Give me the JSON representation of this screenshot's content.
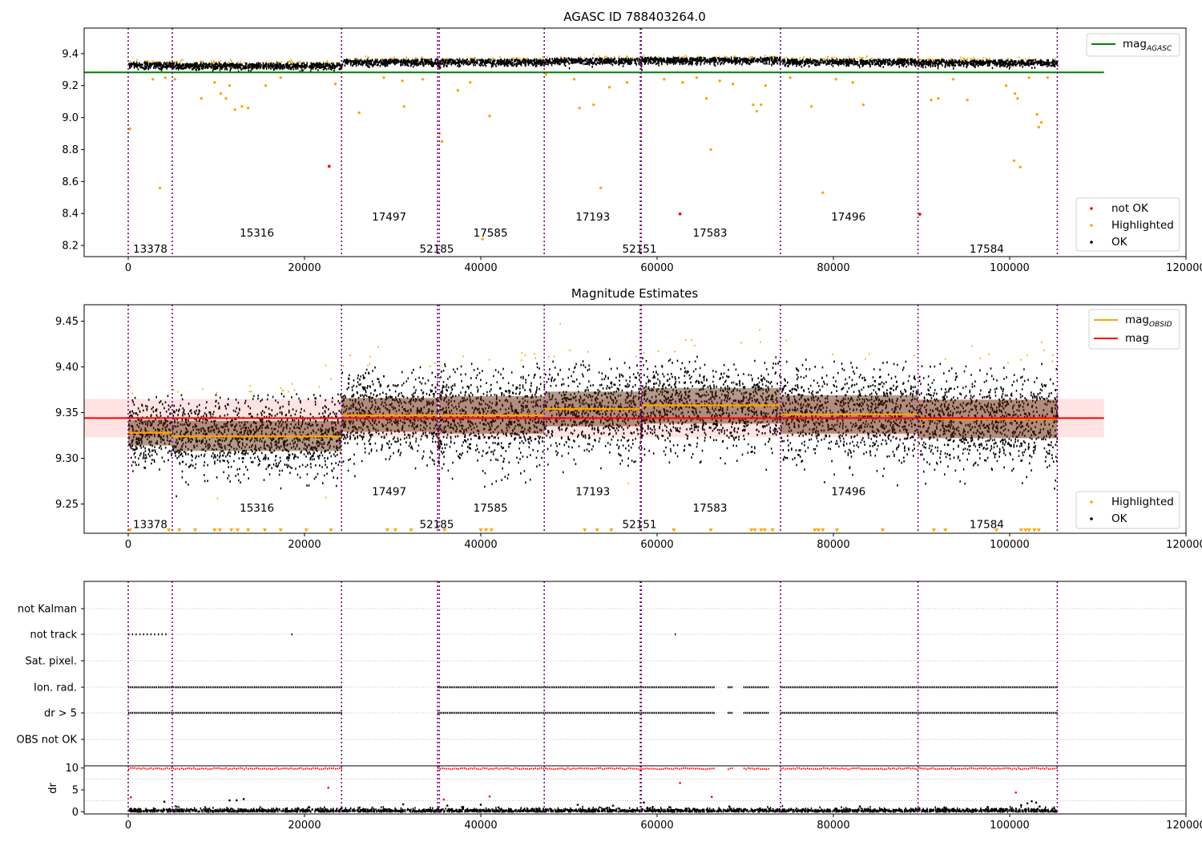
{
  "chart_data": [
    {
      "type": "scatter",
      "title": "AGASC ID 788403264.0",
      "xlim": [
        -5000,
        120000
      ],
      "ylim": [
        8.13,
        9.56
      ],
      "x_ticks": [
        0,
        20000,
        40000,
        60000,
        80000,
        100000,
        120000
      ],
      "y_ticks": [
        8.2,
        8.4,
        8.6,
        8.8,
        9.0,
        9.2,
        9.4
      ],
      "mag_agasc": 9.283,
      "mag_agasc_x_range": [
        -5000,
        110700
      ],
      "legend_lines": [
        {
          "label": "mag",
          "subscript": "AGASC",
          "color": "#008000"
        }
      ],
      "legend_points": [
        {
          "label": "not OK",
          "color": "#ff0000"
        },
        {
          "label": "Highlighted",
          "color": "#ffa500"
        },
        {
          "label": "OK",
          "color": "#000000"
        }
      ],
      "not_ok_points": [
        [
          22800,
          8.695
        ],
        [
          62600,
          8.397
        ],
        [
          89800,
          8.395
        ]
      ],
      "highlighted_outliers": [
        [
          200,
          8.93
        ],
        [
          3600,
          8.56
        ],
        [
          2800,
          9.24
        ],
        [
          4200,
          9.25
        ],
        [
          5300,
          9.24
        ],
        [
          8300,
          9.12
        ],
        [
          9800,
          9.22
        ],
        [
          10500,
          9.15
        ],
        [
          11100,
          9.12
        ],
        [
          11500,
          9.2
        ],
        [
          12100,
          9.05
        ],
        [
          12900,
          9.07
        ],
        [
          13600,
          9.06
        ],
        [
          15600,
          9.2
        ],
        [
          17300,
          9.25
        ],
        [
          23500,
          9.21
        ],
        [
          26200,
          9.03
        ],
        [
          29000,
          9.25
        ],
        [
          31100,
          9.23
        ],
        [
          31300,
          9.07
        ],
        [
          33400,
          9.24
        ],
        [
          35600,
          8.85
        ],
        [
          35300,
          8.9
        ],
        [
          37400,
          9.17
        ],
        [
          38800,
          9.22
        ],
        [
          40200,
          8.24
        ],
        [
          41000,
          9.01
        ],
        [
          47400,
          9.27
        ],
        [
          50600,
          9.24
        ],
        [
          51200,
          9.06
        ],
        [
          52800,
          9.08
        ],
        [
          53600,
          8.56
        ],
        [
          54600,
          9.19
        ],
        [
          56600,
          9.22
        ],
        [
          58200,
          8.9
        ],
        [
          60800,
          9.24
        ],
        [
          62900,
          9.22
        ],
        [
          64500,
          9.25
        ],
        [
          65600,
          9.12
        ],
        [
          66100,
          8.8
        ],
        [
          67100,
          9.23
        ],
        [
          68600,
          9.21
        ],
        [
          70900,
          9.08
        ],
        [
          71300,
          9.04
        ],
        [
          71800,
          9.08
        ],
        [
          72300,
          9.2
        ],
        [
          75100,
          9.25
        ],
        [
          77500,
          9.07
        ],
        [
          78800,
          8.53
        ],
        [
          80300,
          9.24
        ],
        [
          82200,
          9.22
        ],
        [
          83400,
          9.08
        ],
        [
          91100,
          9.11
        ],
        [
          91900,
          9.12
        ],
        [
          93600,
          9.24
        ],
        [
          95200,
          9.11
        ],
        [
          99600,
          9.2
        ],
        [
          100500,
          8.73
        ],
        [
          101200,
          8.69
        ],
        [
          100600,
          9.15
        ],
        [
          100900,
          9.12
        ],
        [
          102200,
          9.25
        ],
        [
          103100,
          9.02
        ],
        [
          103300,
          8.94
        ],
        [
          103600,
          8.97
        ],
        [
          104300,
          9.25
        ]
      ],
      "obsids": [
        {
          "label": "13378",
          "x": 2500,
          "y": 8.18
        },
        {
          "label": "15316",
          "x": 14600,
          "y": 8.28
        },
        {
          "label": "17497",
          "x": 29600,
          "y": 8.38
        },
        {
          "label": "52185",
          "x": 35000,
          "y": 8.18
        },
        {
          "label": "17585",
          "x": 41100,
          "y": 8.28
        },
        {
          "label": "17193",
          "x": 52700,
          "y": 8.38
        },
        {
          "label": "52151",
          "x": 58000,
          "y": 8.18
        },
        {
          "label": "17583",
          "x": 66000,
          "y": 8.28
        },
        {
          "label": "17496",
          "x": 81700,
          "y": 8.38
        },
        {
          "label": "17584",
          "x": 97400,
          "y": 8.18
        }
      ]
    },
    {
      "type": "scatter",
      "title": "Magnitude Estimates",
      "xlim": [
        -5000,
        120000
      ],
      "ylim": [
        9.218,
        9.468
      ],
      "x_ticks": [
        0,
        20000,
        40000,
        60000,
        80000,
        100000,
        120000
      ],
      "y_ticks": [
        9.25,
        9.3,
        9.35,
        9.4,
        9.45
      ],
      "mag": 9.344,
      "mag_band": [
        9.323,
        9.365
      ],
      "mag_x_range": [
        -5000,
        110700
      ],
      "legend_lines": [
        {
          "label": "mag",
          "subscript": "OBSID",
          "color": "#ffa500"
        },
        {
          "label": "mag",
          "subscript": "",
          "color": "#ff0000"
        }
      ],
      "legend_points": [
        {
          "label": "Highlighted",
          "color": "#ffa500"
        },
        {
          "label": "OK",
          "color": "#000000"
        }
      ],
      "obsid_mags": [
        {
          "x0": 0,
          "x1": 5000,
          "mag": 9.328,
          "low": 9.314,
          "high": 9.342
        },
        {
          "x0": 5000,
          "x1": 24200,
          "mag": 9.324,
          "low": 9.308,
          "high": 9.341
        },
        {
          "x0": 24200,
          "x1": 35100,
          "mag": 9.347,
          "low": 9.329,
          "high": 9.366
        },
        {
          "x0": 35100,
          "x1": 35300,
          "mag": 9.324,
          "low": 9.31,
          "high": 9.34
        },
        {
          "x0": 35300,
          "x1": 47200,
          "mag": 9.347,
          "low": 9.327,
          "high": 9.368
        },
        {
          "x0": 47200,
          "x1": 58100,
          "mag": 9.354,
          "low": 9.335,
          "high": 9.373
        },
        {
          "x0": 58100,
          "x1": 58200,
          "mag": 9.33,
          "low": 9.316,
          "high": 9.345
        },
        {
          "x0": 58200,
          "x1": 74000,
          "mag": 9.358,
          "low": 9.338,
          "high": 9.377
        },
        {
          "x0": 74000,
          "x1": 89600,
          "mag": 9.348,
          "low": 9.327,
          "high": 9.369
        },
        {
          "x0": 89600,
          "x1": 105400,
          "mag": 9.343,
          "low": 9.322,
          "high": 9.364
        }
      ],
      "obsids": [
        {
          "label": "13378",
          "x": 2500,
          "y": 9.228
        },
        {
          "label": "15316",
          "x": 14600,
          "y": 9.246
        },
        {
          "label": "17497",
          "x": 29600,
          "y": 9.264
        },
        {
          "label": "52185",
          "x": 35000,
          "y": 9.228
        },
        {
          "label": "17585",
          "x": 41100,
          "y": 9.246
        },
        {
          "label": "17193",
          "x": 52700,
          "y": 9.264
        },
        {
          "label": "52151",
          "x": 58000,
          "y": 9.228
        },
        {
          "label": "17583",
          "x": 66000,
          "y": 9.246
        },
        {
          "label": "17496",
          "x": 81700,
          "y": 9.264
        },
        {
          "label": "17584",
          "x": 97400,
          "y": 9.228
        }
      ]
    },
    {
      "type": "scatter",
      "title": "",
      "xlim": [
        -5000,
        120000
      ],
      "categories": [
        "not Kalman",
        "not track",
        "Sat. pixel.",
        "Ion. rad.",
        "dr > 5",
        "OBS not OK"
      ],
      "not_track_ranges": [
        [
          0,
          4500
        ],
        [
          18500,
          18700
        ],
        [
          62000,
          62200
        ]
      ],
      "ion_rad_ranges": [
        [
          0,
          24200
        ],
        [
          35100,
          66500
        ],
        [
          68000,
          68500
        ],
        [
          69800,
          72600
        ],
        [
          74000,
          105400
        ]
      ],
      "dr_gt5_ranges": [
        [
          0,
          24200
        ],
        [
          35100,
          66500
        ],
        [
          68000,
          68500
        ],
        [
          69800,
          72600
        ],
        [
          74000,
          105400
        ]
      ]
    },
    {
      "type": "scatter",
      "title": "",
      "xlim": [
        -5000,
        120000
      ],
      "ylim": [
        -0.5,
        10.5
      ],
      "ylabel": "dr",
      "x_ticks": [
        0,
        20000,
        40000,
        60000,
        80000,
        100000,
        120000
      ],
      "y_ticks": [
        0,
        5,
        10
      ],
      "red_outliers": [
        [
          22700,
          5.5
        ],
        [
          62600,
          6.6
        ],
        [
          41000,
          3.5
        ],
        [
          66200,
          3.4
        ],
        [
          100700,
          4.4
        ],
        [
          300,
          3.3
        ],
        [
          35800,
          2.8
        ]
      ],
      "black_outliers": [
        [
          4100,
          2.3
        ],
        [
          11500,
          2.6
        ],
        [
          12300,
          2.6
        ],
        [
          13100,
          2.9
        ],
        [
          31200,
          1.7
        ],
        [
          36200,
          1.4
        ],
        [
          38000,
          1.1
        ],
        [
          40000,
          1.6
        ],
        [
          42000,
          1.0
        ],
        [
          51000,
          1.6
        ],
        [
          53500,
          1.0
        ],
        [
          55000,
          1.4
        ],
        [
          58500,
          2.1
        ],
        [
          59500,
          1.1
        ],
        [
          61500,
          1.0
        ],
        [
          68200,
          1.2
        ],
        [
          83000,
          1.2
        ],
        [
          92600,
          1.0
        ],
        [
          97500,
          1.1
        ],
        [
          101300,
          1.5
        ],
        [
          102000,
          1.9
        ],
        [
          102500,
          2.4
        ],
        [
          103000,
          2.1
        ],
        [
          103400,
          1.2
        ]
      ]
    }
  ],
  "vlines_x": [
    0,
    5000,
    24200,
    35100,
    35300,
    47200,
    58100,
    58200,
    74000,
    89600,
    105400
  ]
}
